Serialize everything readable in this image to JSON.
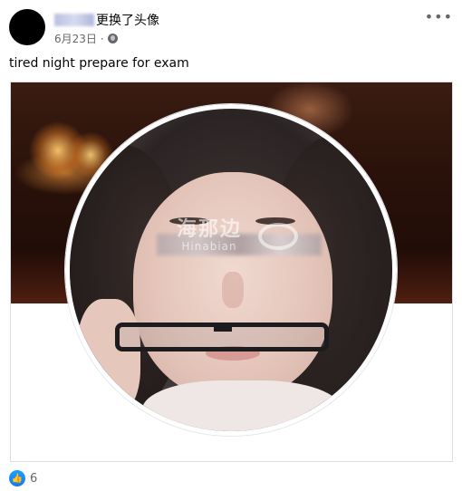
{
  "post": {
    "author_action": "更换了头像",
    "date": "6月23日",
    "separator": "·",
    "text": "tired night prepare for exam"
  },
  "image": {
    "watermark_cn": "海那边",
    "watermark_en": "Hinabian"
  },
  "footer": {
    "like_count": "6"
  },
  "icons": {
    "more": "more-options-icon",
    "audience": "globe-icon",
    "like": "like-icon"
  },
  "colors": {
    "meta_text": "#65676b",
    "like_blue": "#1877f2"
  }
}
